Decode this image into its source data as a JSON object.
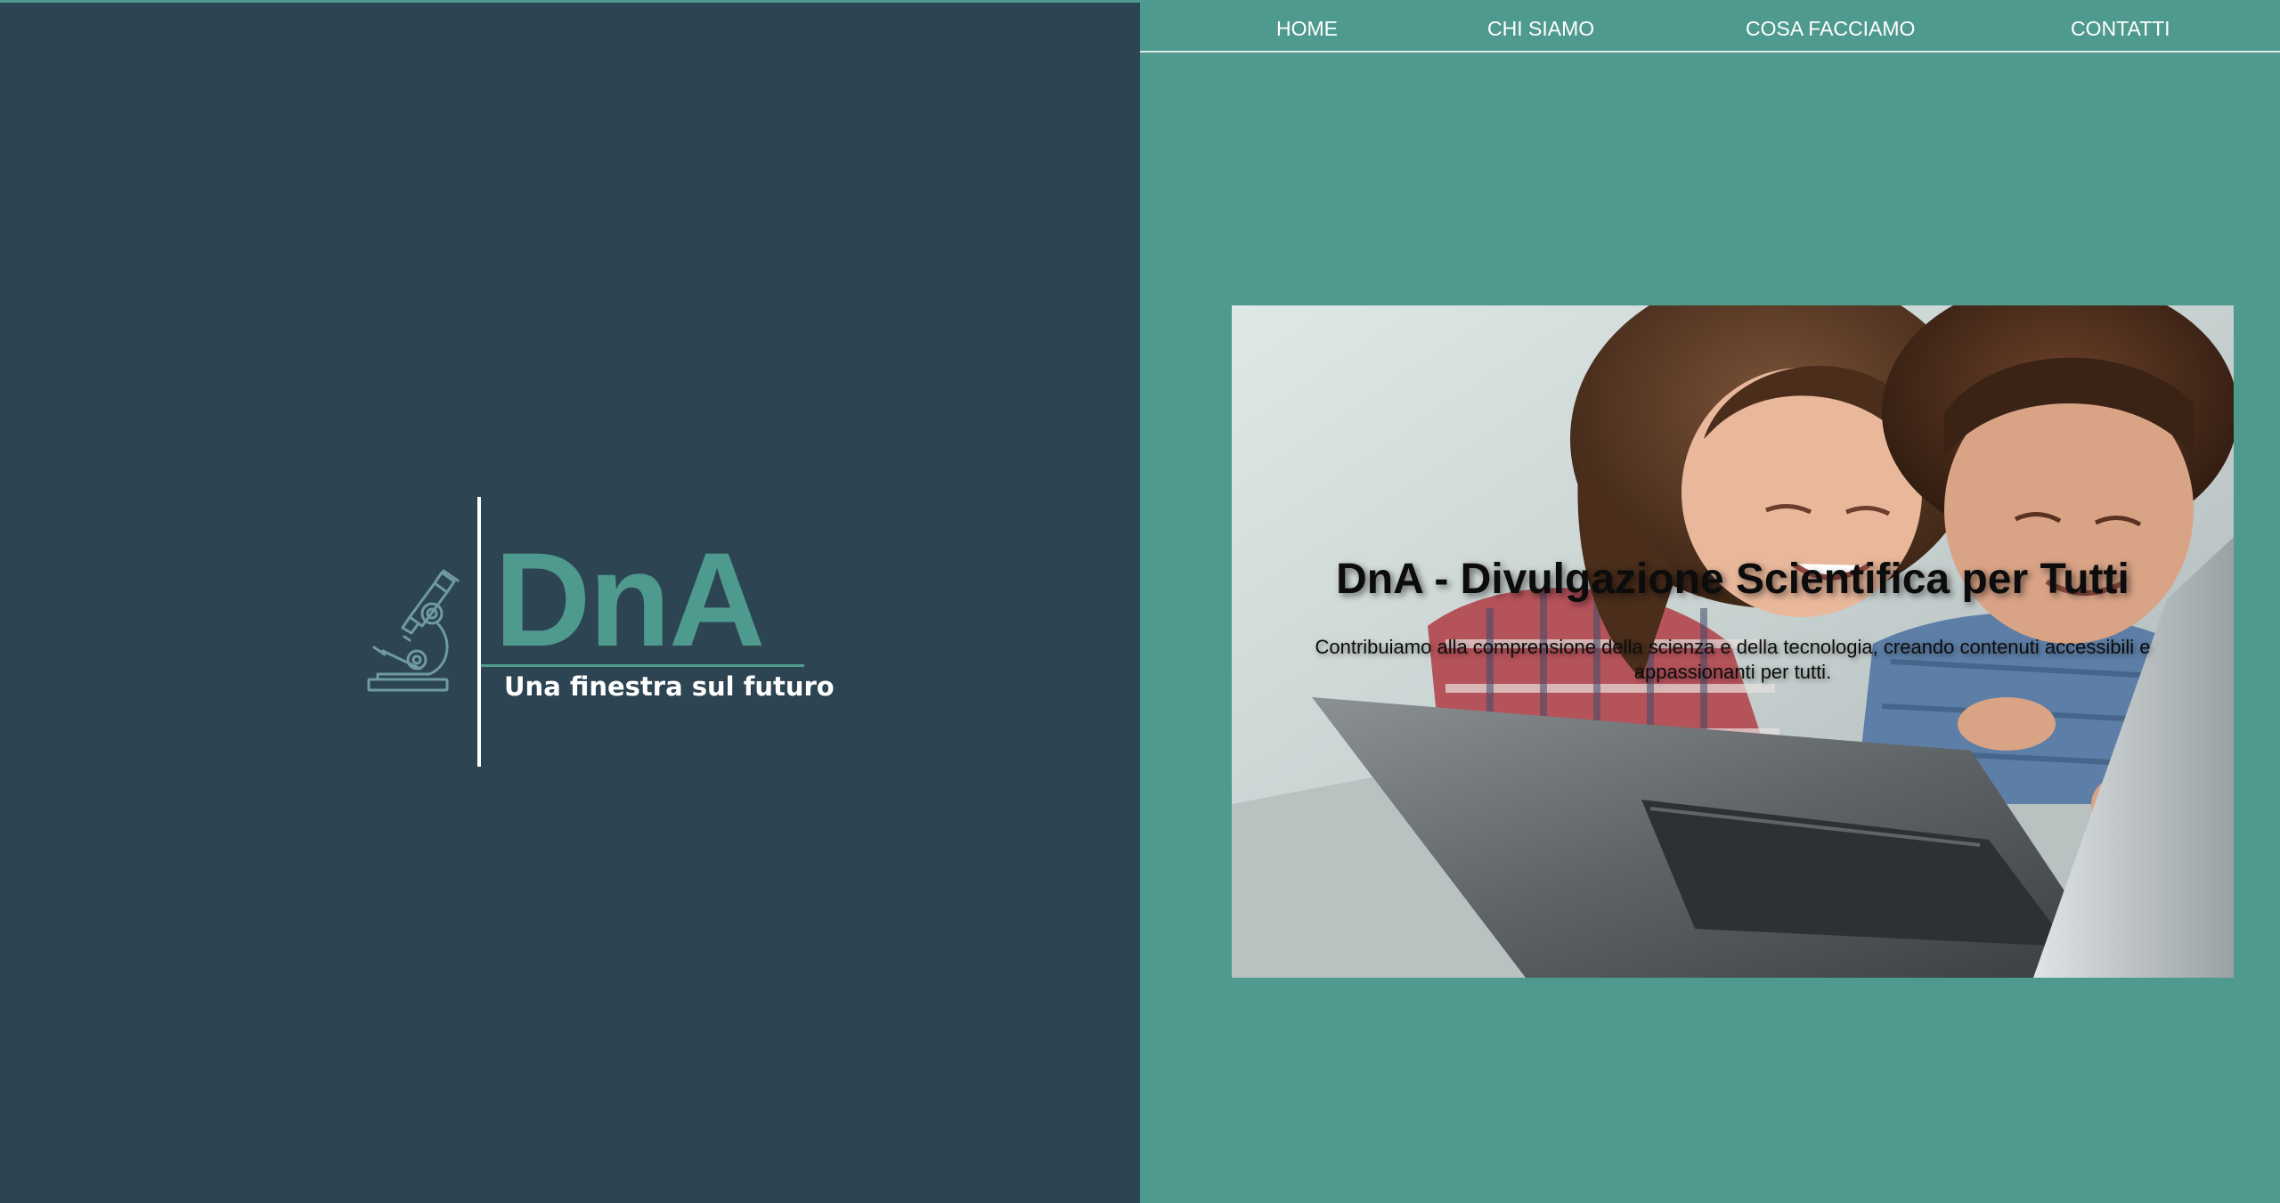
{
  "nav": {
    "items": [
      {
        "label": "HOME"
      },
      {
        "label": "CHI SIAMO"
      },
      {
        "label": "COSA FACCIAMO"
      },
      {
        "label": "CONTATTI"
      }
    ]
  },
  "logo": {
    "title": "DnA",
    "tagline": "Una finestra sul futuro",
    "icon": "microscope-icon"
  },
  "hero": {
    "title": "DnA - Divulgazione Scientifica per Tutti",
    "subtitle": "Contribuiamo alla comprensione della scienza e della tecnologia, creando contenuti accessibili e appassionanti per tutti."
  },
  "colors": {
    "left_panel": "#2d4452",
    "right_panel": "#4f9a8e",
    "accent": "#4f9a8e",
    "text_light": "#ffffff",
    "text_dark": "#0c0c0c"
  }
}
